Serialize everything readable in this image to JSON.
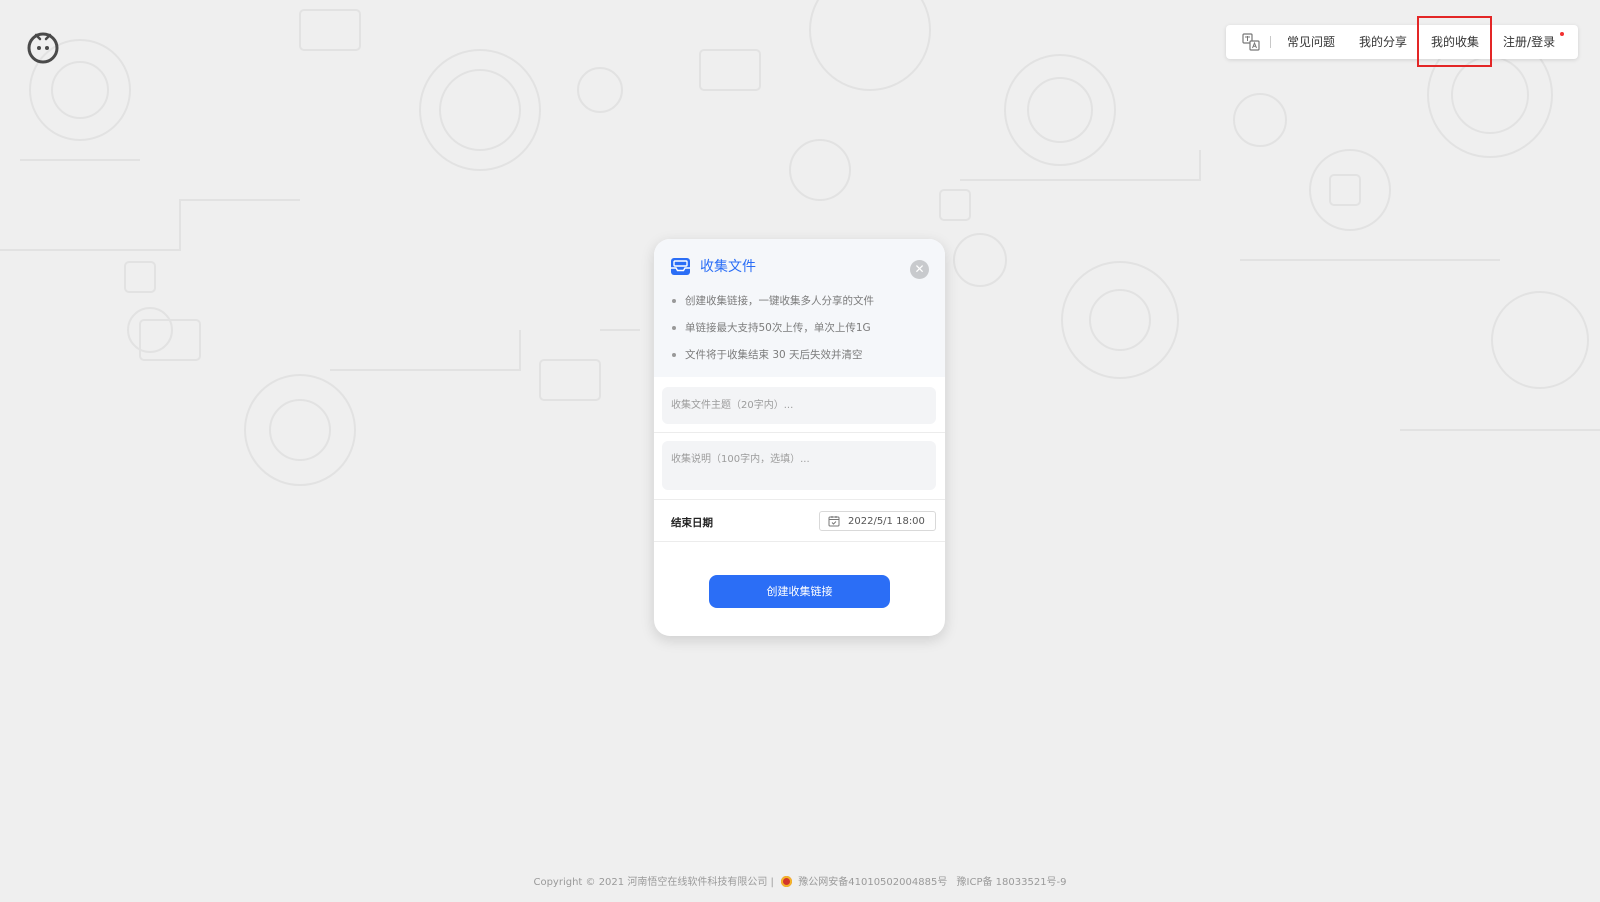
{
  "nav": {
    "translate_icon": "translate-icon",
    "items": [
      {
        "label": "常见问题"
      },
      {
        "label": "我的分享"
      },
      {
        "label": "我的收集"
      },
      {
        "label": "注册/登录"
      }
    ],
    "highlighted": "我的收集"
  },
  "card": {
    "title": "收集文件",
    "title_icon": "inbox-icon",
    "close_icon": "close-icon",
    "bullets": [
      "创建收集链接，一键收集多人分享的文件",
      "单链接最大支持50次上传，单次上传1G",
      "文件将于收集结束 30 天后失效并清空"
    ],
    "topic_placeholder": "收集文件主题（20字内）...",
    "desc_placeholder": "收集说明（100字内，选填）...",
    "date_label": "结束日期",
    "date_icon": "calendar-icon",
    "date_value": "2022/5/1 18:00",
    "create_button": "创建收集链接"
  },
  "footer": {
    "copyright": "Copyright © 2021 河南悟空在线软件科技有限公司 |",
    "police": "豫公网安备41010502004885号",
    "icp": "豫ICP备 18033521号-9"
  },
  "colors": {
    "accent": "#2b6ef6",
    "highlight": "#e32626",
    "background": "#efefef"
  }
}
